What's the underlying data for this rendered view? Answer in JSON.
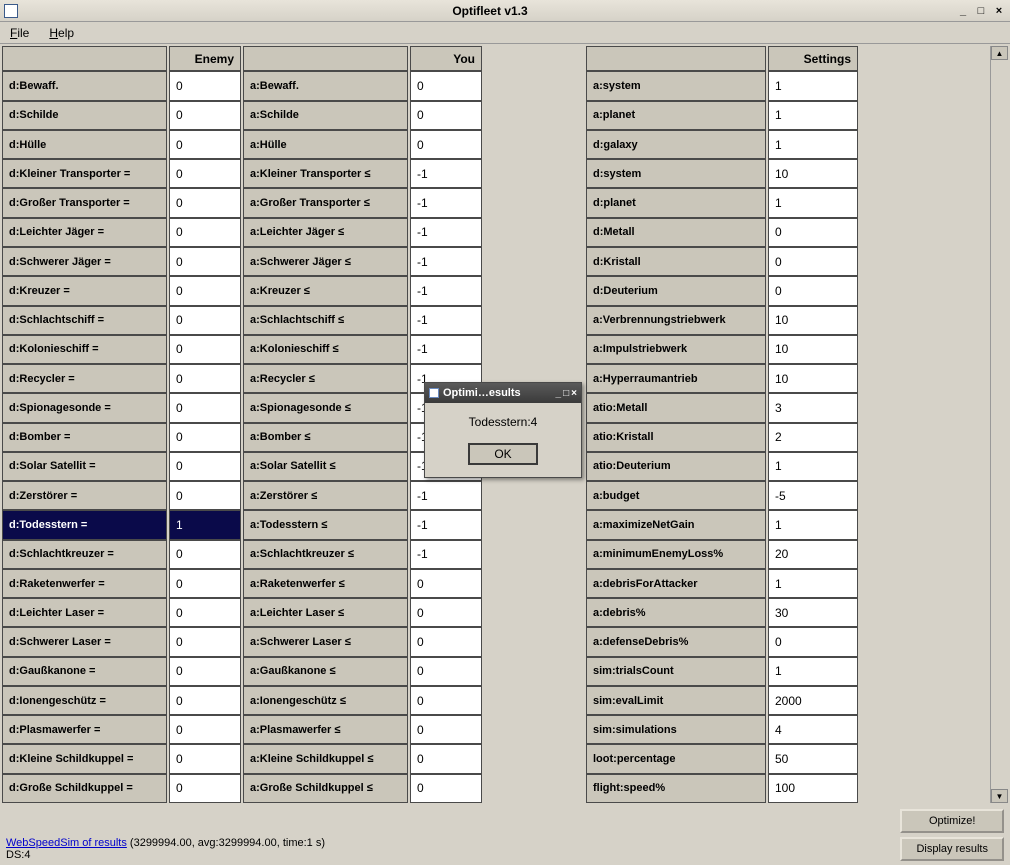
{
  "window": {
    "title": "Optifleet v1.3",
    "min": "_",
    "max": "□",
    "close": "×"
  },
  "menu": {
    "file": "File",
    "help": "Help"
  },
  "headers": {
    "enemy": "Enemy",
    "you": "You",
    "settings": "Settings"
  },
  "enemy_rows": [
    {
      "label": "d:Bewaff.",
      "val": "0"
    },
    {
      "label": "d:Schilde",
      "val": "0"
    },
    {
      "label": "d:Hülle",
      "val": "0"
    },
    {
      "label": "d:Kleiner Transporter =",
      "val": "0"
    },
    {
      "label": "d:Großer Transporter =",
      "val": "0"
    },
    {
      "label": "d:Leichter Jäger =",
      "val": "0"
    },
    {
      "label": "d:Schwerer Jäger =",
      "val": "0"
    },
    {
      "label": "d:Kreuzer =",
      "val": "0"
    },
    {
      "label": "d:Schlachtschiff =",
      "val": "0"
    },
    {
      "label": "d:Kolonieschiff =",
      "val": "0"
    },
    {
      "label": "d:Recycler =",
      "val": "0"
    },
    {
      "label": "d:Spionagesonde =",
      "val": "0"
    },
    {
      "label": "d:Bomber =",
      "val": "0"
    },
    {
      "label": "d:Solar Satellit =",
      "val": "0"
    },
    {
      "label": "d:Zerstörer =",
      "val": "0"
    },
    {
      "label": "d:Todesstern =",
      "val": "1",
      "selected": true
    },
    {
      "label": "d:Schlachtkreuzer =",
      "val": "0"
    },
    {
      "label": "d:Raketenwerfer =",
      "val": "0"
    },
    {
      "label": "d:Leichter Laser =",
      "val": "0"
    },
    {
      "label": "d:Schwerer Laser =",
      "val": "0"
    },
    {
      "label": "d:Gaußkanone =",
      "val": "0"
    },
    {
      "label": "d:Ionengeschütz =",
      "val": "0"
    },
    {
      "label": "d:Plasmawerfer =",
      "val": "0"
    },
    {
      "label": "d:Kleine Schildkuppel =",
      "val": "0"
    },
    {
      "label": "d:Große Schildkuppel =",
      "val": "0"
    }
  ],
  "you_rows": [
    {
      "label": "a:Bewaff.",
      "val": "0"
    },
    {
      "label": "a:Schilde",
      "val": "0"
    },
    {
      "label": "a:Hülle",
      "val": "0"
    },
    {
      "label": "a:Kleiner Transporter ≤",
      "val": "-1"
    },
    {
      "label": "a:Großer Transporter ≤",
      "val": "-1"
    },
    {
      "label": "a:Leichter Jäger ≤",
      "val": "-1"
    },
    {
      "label": "a:Schwerer Jäger ≤",
      "val": "-1"
    },
    {
      "label": "a:Kreuzer ≤",
      "val": "-1"
    },
    {
      "label": "a:Schlachtschiff ≤",
      "val": "-1"
    },
    {
      "label": "a:Kolonieschiff ≤",
      "val": "-1"
    },
    {
      "label": "a:Recycler ≤",
      "val": "-1"
    },
    {
      "label": "a:Spionagesonde ≤",
      "val": "-1"
    },
    {
      "label": "a:Bomber ≤",
      "val": "-1"
    },
    {
      "label": "a:Solar Satellit ≤",
      "val": "-1"
    },
    {
      "label": "a:Zerstörer ≤",
      "val": "-1"
    },
    {
      "label": "a:Todesstern ≤",
      "val": "-1"
    },
    {
      "label": "a:Schlachtkreuzer ≤",
      "val": "-1"
    },
    {
      "label": "a:Raketenwerfer ≤",
      "val": "0"
    },
    {
      "label": "a:Leichter Laser ≤",
      "val": "0"
    },
    {
      "label": "a:Schwerer Laser ≤",
      "val": "0"
    },
    {
      "label": "a:Gaußkanone ≤",
      "val": "0"
    },
    {
      "label": "a:Ionengeschütz ≤",
      "val": "0"
    },
    {
      "label": "a:Plasmawerfer ≤",
      "val": "0"
    },
    {
      "label": "a:Kleine Schildkuppel ≤",
      "val": "0"
    },
    {
      "label": "a:Große Schildkuppel ≤",
      "val": "0"
    }
  ],
  "settings_rows": [
    {
      "label": "a:system",
      "val": "1"
    },
    {
      "label": "a:planet",
      "val": "1"
    },
    {
      "label": "d:galaxy",
      "val": "1"
    },
    {
      "label": "d:system",
      "val": "10"
    },
    {
      "label": "d:planet",
      "val": "1"
    },
    {
      "label": "d:Metall",
      "val": "0"
    },
    {
      "label": "d:Kristall",
      "val": "0"
    },
    {
      "label": "d:Deuterium",
      "val": "0"
    },
    {
      "label": "a:Verbrennungstriebwerk",
      "val": "10"
    },
    {
      "label": "a:Impulstriebwerk",
      "val": "10"
    },
    {
      "label": "a:Hyperraumantrieb",
      "val": "10"
    },
    {
      "label": "atio:Metall",
      "val": "3"
    },
    {
      "label": "atio:Kristall",
      "val": "2"
    },
    {
      "label": "atio:Deuterium",
      "val": "1"
    },
    {
      "label": "a:budget",
      "val": "-5"
    },
    {
      "label": "a:maximizeNetGain",
      "val": "1"
    },
    {
      "label": "a:minimumEnemyLoss%",
      "val": "20"
    },
    {
      "label": "a:debrisForAttacker",
      "val": "1"
    },
    {
      "label": "a:debris%",
      "val": "30"
    },
    {
      "label": "a:defenseDebris%",
      "val": "0"
    },
    {
      "label": "sim:trialsCount",
      "val": "1"
    },
    {
      "label": "sim:evalLimit",
      "val": "2000"
    },
    {
      "label": "sim:simulations",
      "val": "4"
    },
    {
      "label": "loot:percentage",
      "val": "50"
    },
    {
      "label": "flight:speed%",
      "val": "100"
    }
  ],
  "dialog": {
    "title": "Optimi…esults",
    "body": "Todesstern:4",
    "ok": "OK"
  },
  "footer": {
    "link": "WebSpeedSim of results",
    "info": " (3299994.00, avg:3299994.00, time:1 s)",
    "ds": "DS:4",
    "optimize": "Optimize!",
    "display": "Display results"
  }
}
